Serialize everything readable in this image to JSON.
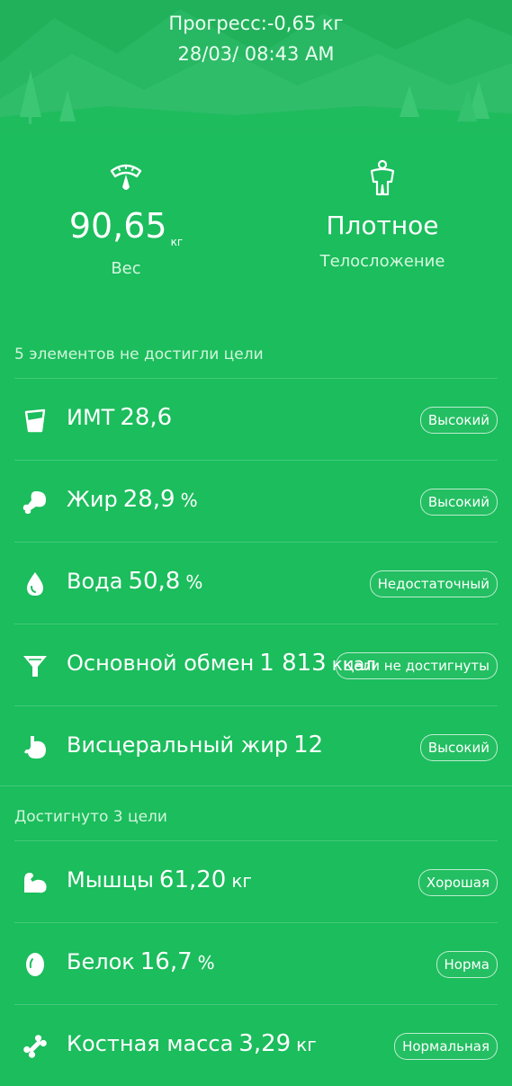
{
  "header": {
    "progress": "Прогресс:-0,65 кг",
    "datetime": "28/03/ 08:43 AM"
  },
  "weight": {
    "value": "90,65",
    "unit": "кг",
    "caption": "Вес"
  },
  "body_type": {
    "value": "Плотное",
    "caption": "Телосложение"
  },
  "not_reached": {
    "title": "5 элементов не достигли цели",
    "items": [
      {
        "icon": "bmi-cup-icon",
        "label": "ИМТ",
        "value": "28,6",
        "unit": "",
        "status": "Высокий"
      },
      {
        "icon": "fat-drumstick-icon",
        "label": "Жир",
        "value": "28,9",
        "unit": "%",
        "status": "Высокий"
      },
      {
        "icon": "water-drop-icon",
        "label": "Вода",
        "value": "50,8",
        "unit": "%",
        "status": "Недостаточный"
      },
      {
        "icon": "funnel-icon",
        "label": "Основной обмен",
        "value": "1 813",
        "unit": "ккал",
        "status": "Цели не достигнуты"
      },
      {
        "icon": "stomach-icon",
        "label": "Висцеральный жир",
        "value": "12",
        "unit": "",
        "status": "Высокий"
      }
    ]
  },
  "reached": {
    "title": "Достигнуто 3 цели",
    "items": [
      {
        "icon": "muscle-arm-icon",
        "label": "Мышцы",
        "value": "61,20",
        "unit": "кг",
        "status": "Хорошая"
      },
      {
        "icon": "egg-icon",
        "label": "Белок",
        "value": "16,7",
        "unit": "%",
        "status": "Норма"
      },
      {
        "icon": "bone-icon",
        "label": "Костная масса",
        "value": "3,29",
        "unit": "кг",
        "status": "Нормальная"
      }
    ]
  }
}
